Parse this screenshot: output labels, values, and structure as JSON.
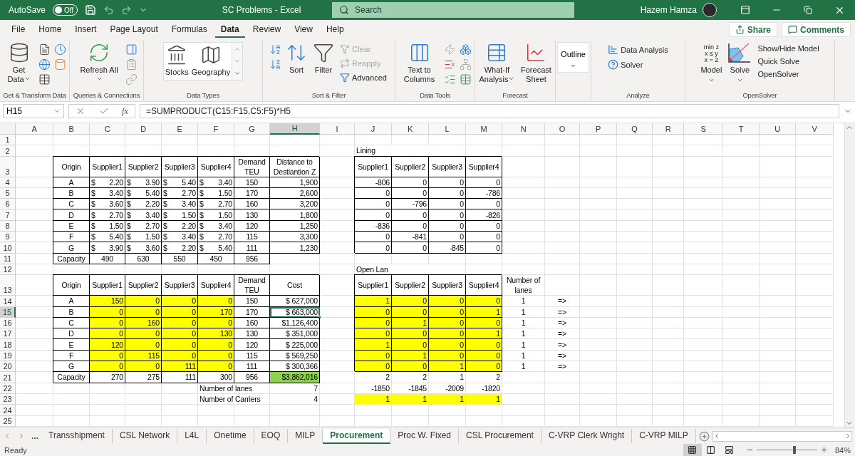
{
  "title_bar": {
    "autosave_label": "AutoSave",
    "autosave": {
      "on": false,
      "label": "Off"
    },
    "title": "SC Problems  -  Excel",
    "search": {
      "placeholder": "Search"
    },
    "user": "Hazem Hamza"
  },
  "menu": {
    "tabs": [
      {
        "label": "File",
        "selected": false
      },
      {
        "label": "Home",
        "selected": false
      },
      {
        "label": "Insert",
        "selected": false
      },
      {
        "label": "Page Layout",
        "selected": false
      },
      {
        "label": "Formulas",
        "selected": false
      },
      {
        "label": "Data",
        "selected": true
      },
      {
        "label": "Review",
        "selected": false
      },
      {
        "label": "View",
        "selected": false
      },
      {
        "label": "Help",
        "selected": false
      }
    ],
    "share": "Share",
    "comments": "Comments"
  },
  "ribbon": {
    "groups": [
      {
        "label": "Get & Transform Data",
        "buttons": [
          {
            "label": "Get Data"
          }
        ]
      },
      {
        "label": "Queries & Connections",
        "buttons": [
          {
            "label": "Refresh All"
          }
        ]
      },
      {
        "label": "Data Types",
        "buttons": [
          {
            "label": "Stocks"
          },
          {
            "label": "Geography"
          }
        ]
      },
      {
        "label": "Sort & Filter",
        "buttons": [
          {
            "label": "Sort"
          },
          {
            "label": "Filter"
          }
        ],
        "small": [
          {
            "label": "Clear",
            "disabled": true
          },
          {
            "label": "Reapply",
            "disabled": true
          },
          {
            "label": "Advanced",
            "disabled": false
          }
        ]
      },
      {
        "label": "Data Tools",
        "buttons": [
          {
            "label": "Text to Columns"
          }
        ]
      },
      {
        "label": "Forecast",
        "buttons": [
          {
            "label": "What-If Analysis"
          },
          {
            "label": "Forecast Sheet"
          }
        ]
      },
      {
        "buttons": [
          {
            "label": "Outline"
          }
        ]
      },
      {
        "label": "Analyze",
        "small": [
          {
            "label": "Data Analysis"
          },
          {
            "label": "Solver"
          }
        ]
      },
      {
        "label": "OpenSolver",
        "model_lines": [
          "min z",
          "x ≤ y",
          "x = 2"
        ],
        "buttons": [
          {
            "label": "Model"
          },
          {
            "label": "Solve"
          }
        ],
        "small": [
          {
            "label": "Show/Hide Model"
          },
          {
            "label": "Quick Solve"
          },
          {
            "label": "OpenSolver"
          }
        ]
      }
    ]
  },
  "formula_bar": {
    "name_box": "H15",
    "function_symbol": "fx",
    "formula": "=SUMPRODUCT(C15:F15,C5:F5)*H5"
  },
  "sheet": {
    "columns": [
      "A",
      "B",
      "C",
      "D",
      "E",
      "F",
      "G",
      "H",
      "I",
      "J",
      "K",
      "L",
      "M",
      "N",
      "O",
      "P",
      "Q",
      "R",
      "S",
      "T",
      "U",
      "V"
    ],
    "row_numbers": [
      "1",
      "2",
      "3",
      "4",
      "5",
      "6",
      "7",
      "8",
      "9",
      "10",
      "11",
      "12",
      "13",
      "14",
      "15",
      "16",
      "17",
      "18",
      "19",
      "20",
      "21",
      "22",
      "23",
      "24",
      "25"
    ],
    "cost_table": {
      "headers": [
        "Origin",
        "Supplier1",
        "Supplier2",
        "Supplier3",
        "Supplier4",
        "Demand TEU",
        "Distance to Destiantion Z"
      ],
      "rows": [
        [
          "A",
          "$ 2.20",
          "$ 3.90",
          "$ 5.40",
          "$ 3.40",
          "150",
          "1,900"
        ],
        [
          "B",
          "$ 3.40",
          "$ 5.40",
          "$ 2.70",
          "$ 1.50",
          "170",
          "2,600"
        ],
        [
          "C",
          "$ 3.60",
          "$ 2.20",
          "$ 3.40",
          "$ 2.70",
          "160",
          "3,200"
        ],
        [
          "D",
          "$ 2.70",
          "$ 3.40",
          "$ 1.50",
          "$ 1.50",
          "130",
          "1,800"
        ],
        [
          "E",
          "$ 1.50",
          "$ 2.70",
          "$ 2.20",
          "$ 3.40",
          "120",
          "1,250"
        ],
        [
          "F",
          "$ 5.40",
          "$ 1.50",
          "$ 3.40",
          "$ 2.70",
          "115",
          "3,300"
        ],
        [
          "G",
          "$ 3.90",
          "$ 3.60",
          "$ 2.20",
          "$ 5.40",
          "111",
          "1,230"
        ]
      ],
      "capacity": [
        "Capacity",
        "490",
        "630",
        "550",
        "450",
        "956"
      ]
    },
    "lining_title": "Lining",
    "lining_table": {
      "headers": [
        "Supplier1",
        "Supplier2",
        "Supplier3",
        "Supplier4"
      ],
      "rows": [
        [
          "-806",
          "0",
          "0",
          "0"
        ],
        [
          "0",
          "0",
          "0",
          "-786"
        ],
        [
          "0",
          "-796",
          "0",
          "0"
        ],
        [
          "0",
          "0",
          "0",
          "-826"
        ],
        [
          "-836",
          "0",
          "0",
          "0"
        ],
        [
          "0",
          "-841",
          "0",
          "0"
        ],
        [
          "0",
          "0",
          "-845",
          "0"
        ]
      ]
    },
    "open_lanes_title": "Open Lan",
    "allocation_table": {
      "headers": [
        "Origin",
        "Supplier1",
        "Supplier2",
        "Supplier3",
        "Supplier4",
        "Demand TEU",
        "Cost"
      ],
      "rows": [
        {
          "cells": [
            "A",
            "150",
            "0",
            "0",
            "0",
            "150"
          ],
          "cost": "$   627,000",
          "selected": false
        },
        {
          "cells": [
            "B",
            "0",
            "0",
            "0",
            "170",
            "170"
          ],
          "cost": "$   663,000",
          "selected": true
        },
        {
          "cells": [
            "C",
            "0",
            "160",
            "0",
            "0",
            "160"
          ],
          "cost": "$1,126,400",
          "selected": false
        },
        {
          "cells": [
            "D",
            "0",
            "0",
            "0",
            "130",
            "130"
          ],
          "cost": "$   351,000",
          "selected": false
        },
        {
          "cells": [
            "E",
            "120",
            "0",
            "0",
            "0",
            "120"
          ],
          "cost": "$   225,000",
          "selected": false
        },
        {
          "cells": [
            "F",
            "0",
            "115",
            "0",
            "0",
            "115"
          ],
          "cost": "$   569,250",
          "selected": false
        },
        {
          "cells": [
            "G",
            "0",
            "0",
            "111",
            "0",
            "111"
          ],
          "cost": "$   300,366",
          "selected": false
        }
      ],
      "totals": [
        "Capacity",
        "270",
        "275",
        "111",
        "300",
        "956"
      ],
      "total_cost": "$3,862,016"
    },
    "summary": [
      {
        "label": "Number of lanes",
        "value": "7"
      },
      {
        "label": "Number of Carriers",
        "value": "4"
      }
    ],
    "open_lanes_table": {
      "headers": [
        "Supplier1",
        "Supplier2",
        "Supplier3",
        "Supplier4"
      ],
      "lanes_header": "Number of lanes",
      "rows": [
        {
          "values": [
            "1",
            "0",
            "0",
            "0"
          ],
          "lanes": "1",
          "arrow": "=>"
        },
        {
          "values": [
            "0",
            "0",
            "0",
            "1"
          ],
          "lanes": "1",
          "arrow": "=>"
        },
        {
          "values": [
            "0",
            "1",
            "0",
            "0"
          ],
          "lanes": "1",
          "arrow": "=>"
        },
        {
          "values": [
            "0",
            "0",
            "0",
            "1"
          ],
          "lanes": "1",
          "arrow": "=>"
        },
        {
          "values": [
            "1",
            "0",
            "0",
            "0"
          ],
          "lanes": "1",
          "arrow": "=>"
        },
        {
          "values": [
            "0",
            "1",
            "0",
            "0"
          ],
          "lanes": "1",
          "arrow": "=>"
        },
        {
          "values": [
            "0",
            "0",
            "1",
            "0"
          ],
          "lanes": "1",
          "arrow": "=>"
        }
      ],
      "counts": [
        "2",
        "2",
        "1",
        "2"
      ],
      "scores": [
        "-1850",
        "-1845",
        "-2009",
        "-1820"
      ],
      "open": [
        "1",
        "1",
        "1",
        "1"
      ]
    }
  },
  "sheet_tabs": {
    "overflow": "...",
    "tabs": [
      {
        "label": "Transshipment",
        "selected": false
      },
      {
        "label": "CSL Network",
        "selected": false
      },
      {
        "label": "L4L",
        "selected": false
      },
      {
        "label": "Onetime",
        "selected": false
      },
      {
        "label": "EOQ",
        "selected": false
      },
      {
        "label": "MILP",
        "selected": false
      },
      {
        "label": "Procurement",
        "selected": true
      },
      {
        "label": "Proc W. Fixed",
        "selected": false
      },
      {
        "label": "CSL Procurement",
        "selected": false
      },
      {
        "label": "C-VRP Clerk Wright",
        "selected": false
      },
      {
        "label": "C-VRP MILP",
        "selected": false
      }
    ]
  },
  "status_bar": {
    "status": "Ready",
    "zoom": {
      "level": 0.62,
      "label": "84%"
    }
  }
}
